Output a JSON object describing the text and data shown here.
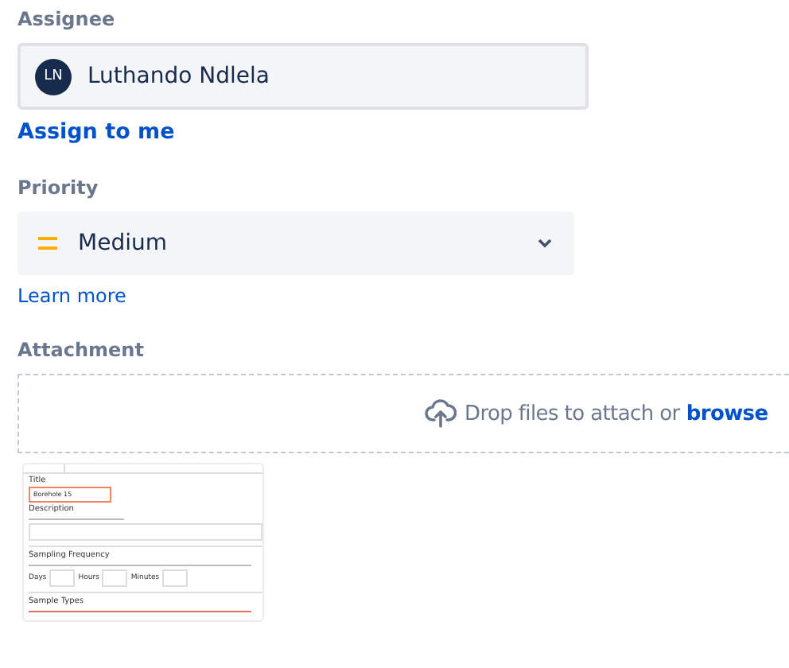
{
  "assignee": {
    "label": "Assignee",
    "initials": "LN",
    "name": "Luthando Ndlela",
    "link": "Assign to me"
  },
  "priority": {
    "label": "Priority",
    "value": "Medium",
    "link": "Learn more"
  },
  "attachment": {
    "label": "Attachment",
    "drop_text": "Drop files to attach or",
    "browse": "browse",
    "thumbnail": {
      "fields": [
        {
          "kind": "input",
          "label": "Title",
          "value": "Borehole 15"
        },
        {
          "kind": "textarea",
          "label": "Description"
        },
        {
          "kind": "frequency",
          "label": "Sampling Frequency",
          "units": [
            "Days",
            "Hours",
            "Minutes"
          ]
        },
        {
          "kind": "heading",
          "label": "Sample Types"
        }
      ]
    }
  }
}
